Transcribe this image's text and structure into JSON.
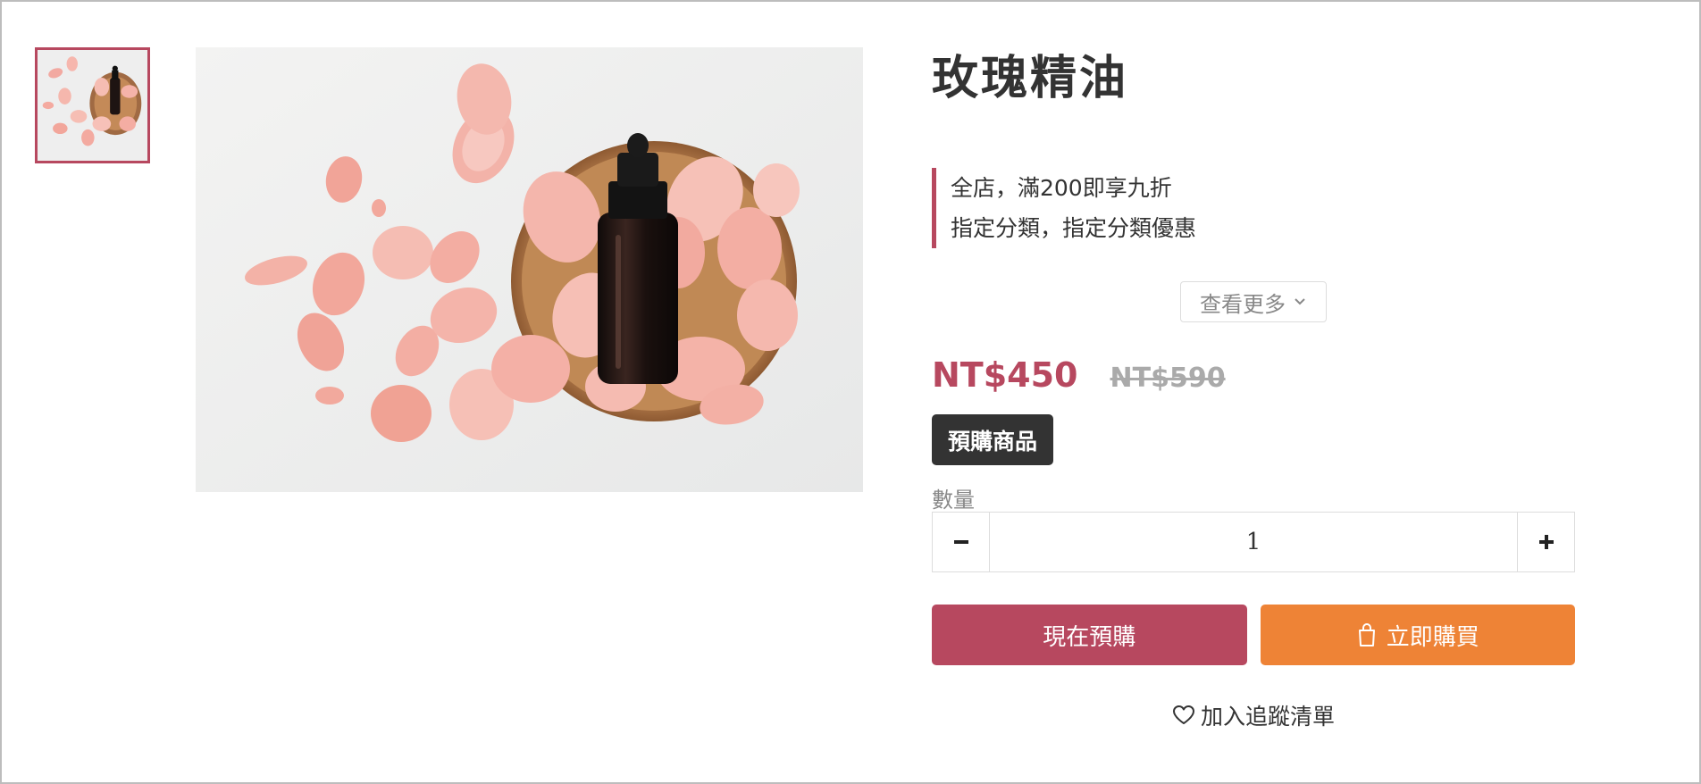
{
  "product": {
    "title": "玫瑰精油",
    "image_alt": "rose-essential-oil-photo"
  },
  "promotions": [
    "全店，滿200即享九折",
    "指定分類，指定分類優惠"
  ],
  "see_more_label": "查看更多",
  "price": {
    "sale": "NT$450",
    "original": "NT$590"
  },
  "badge_label": "預購商品",
  "quantity": {
    "label": "數量",
    "value": "1"
  },
  "actions": {
    "preorder_label": "現在預購",
    "buy_now_label": "立即購買"
  },
  "wishlist_label": "加入追蹤清單",
  "colors": {
    "accent": "#b7485f",
    "buy": "#ee8336",
    "badge": "#333333"
  },
  "icons": [
    "chevron-down-icon",
    "minus-icon",
    "plus-icon",
    "shopping-bag-icon",
    "heart-icon"
  ]
}
